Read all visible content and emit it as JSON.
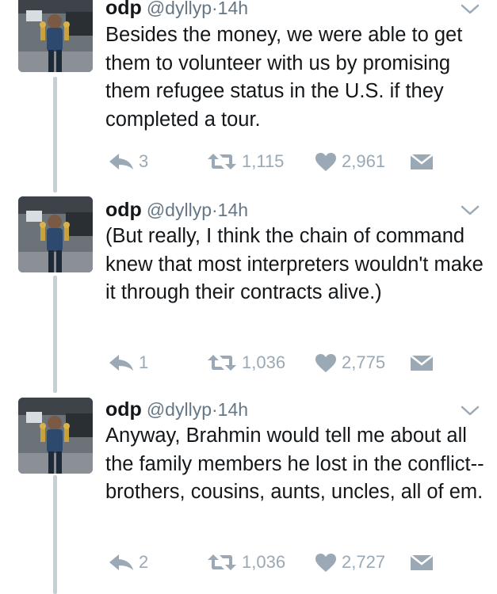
{
  "tweets": [
    {
      "author": {
        "name": "odp",
        "handle": "@dyllyp",
        "avatar_icon": "profile-photo-with-trophies"
      },
      "separator": "·",
      "time": "14h",
      "text": "Besides the money, we were able to get them to volunteer with us by promising them refugee status in the U.S. if they completed a tour.",
      "replies": "3",
      "retweets": "1,115",
      "likes": "2,961"
    },
    {
      "author": {
        "name": "odp",
        "handle": "@dyllyp",
        "avatar_icon": "profile-photo-with-trophies"
      },
      "separator": "·",
      "time": "14h",
      "text": "(But really, I think the chain of command knew that most interpreters wouldn't make it through their contracts alive.)",
      "replies": "1",
      "retweets": "1,036",
      "likes": "2,775"
    },
    {
      "author": {
        "name": "odp",
        "handle": "@dyllyp",
        "avatar_icon": "profile-photo-with-trophies"
      },
      "separator": "·",
      "time": "14h",
      "text": "Anyway, Brahmin would tell me about all the family members he lost in the conflict--brothers, cousins, aunts, uncles, all of em.",
      "replies": "2",
      "retweets": "1,036",
      "likes": "2,727"
    }
  ],
  "icons": {
    "reply": "reply-arrow-icon",
    "retweet": "retweet-icon",
    "like": "heart-icon",
    "dm": "envelope-icon",
    "menu": "chevron-down-icon"
  },
  "colors": {
    "text": "#14171a",
    "meta": "#657786",
    "action": "#9aa9b5",
    "thread_line": "#c4cfd6"
  }
}
